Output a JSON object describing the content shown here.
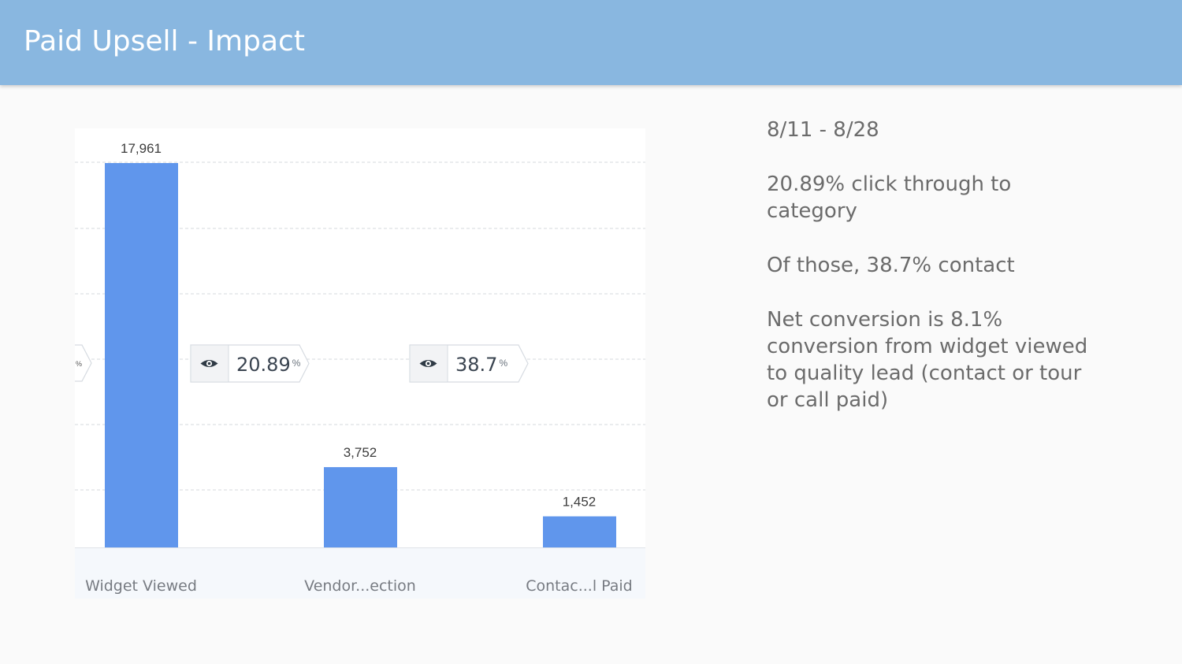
{
  "header": {
    "title": "Paid Upsell - Impact"
  },
  "notes": [
    "8/11 - 8/28",
    "20.89% click through to category",
    "Of those, 38.7% contact",
    "Net conversion is 8.1% conversion from widget viewed to quality lead (contact or tour or call paid)"
  ],
  "icons": {
    "conversion": "eye-icon"
  },
  "colors": {
    "bar": "#6096ec",
    "header": "#89b7e0",
    "gridline": "#d6d9de"
  },
  "chart_data": {
    "type": "bar",
    "categories": [
      "Widget Viewed",
      "Vendor...ection",
      "Contac...l Paid"
    ],
    "values": [
      17961,
      3752,
      1452
    ],
    "value_labels": [
      "17,961",
      "3,752",
      "1,452"
    ],
    "conversions": [
      {
        "value": "20.89",
        "unit": "%"
      },
      {
        "value": "38.7",
        "unit": "%"
      }
    ],
    "title": "",
    "xlabel": "",
    "ylabel": "",
    "ylim": [
      0,
      17961
    ],
    "grid": true
  }
}
